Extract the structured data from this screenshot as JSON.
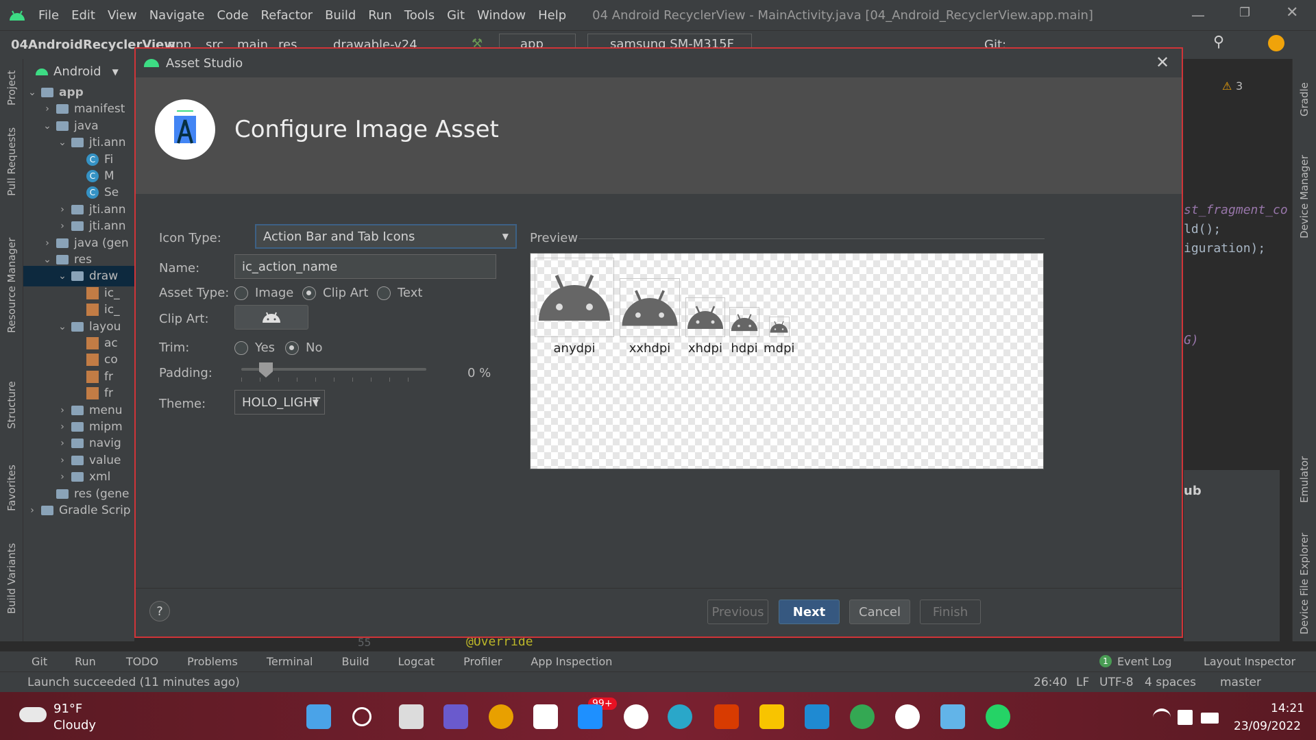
{
  "menu": {
    "items": [
      "File",
      "Edit",
      "View",
      "Navigate",
      "Code",
      "Refactor",
      "Build",
      "Run",
      "Tools",
      "Git",
      "Window",
      "Help"
    ],
    "window_title": "04 Android RecyclerView - MainActivity.java [04_Android_RecyclerView.app.main]"
  },
  "navbar": {
    "project": "04AndroidRecyclerView",
    "crumbs": [
      "app",
      "src",
      "main",
      "res",
      "drawable-v24"
    ],
    "run_config": "app",
    "device": "samsung SM-M315F",
    "git_label": "Git:"
  },
  "left_strip": [
    "Project",
    "Pull Requests",
    "Resource Manager",
    "Structure",
    "Favorites",
    "Build Variants"
  ],
  "right_strip": [
    "Gradle",
    "Device Manager",
    "Emulator",
    "Device File Explorer"
  ],
  "project_panel": {
    "mode": "Android",
    "tree": [
      {
        "label": "app",
        "indent": 0,
        "arrow": "v",
        "kind": "folder",
        "bold": true
      },
      {
        "label": "manifest",
        "indent": 1,
        "arrow": ">",
        "kind": "folder"
      },
      {
        "label": "java",
        "indent": 1,
        "arrow": "v",
        "kind": "folder"
      },
      {
        "label": "jti.ann",
        "indent": 2,
        "arrow": "v",
        "kind": "folder"
      },
      {
        "label": "Fi",
        "indent": 3,
        "arrow": "",
        "kind": "class"
      },
      {
        "label": "M",
        "indent": 3,
        "arrow": "",
        "kind": "class"
      },
      {
        "label": "Se",
        "indent": 3,
        "arrow": "",
        "kind": "class"
      },
      {
        "label": "jti.ann",
        "indent": 2,
        "arrow": ">",
        "kind": "folder"
      },
      {
        "label": "jti.ann",
        "indent": 2,
        "arrow": ">",
        "kind": "folder"
      },
      {
        "label": "java (gen",
        "indent": 1,
        "arrow": ">",
        "kind": "folder"
      },
      {
        "label": "res",
        "indent": 1,
        "arrow": "v",
        "kind": "folder"
      },
      {
        "label": "draw",
        "indent": 2,
        "arrow": "v",
        "kind": "folder",
        "selected": true
      },
      {
        "label": "ic_",
        "indent": 3,
        "arrow": "",
        "kind": "xml"
      },
      {
        "label": "ic_",
        "indent": 3,
        "arrow": "",
        "kind": "xml"
      },
      {
        "label": "layou",
        "indent": 2,
        "arrow": "v",
        "kind": "folder"
      },
      {
        "label": "ac",
        "indent": 3,
        "arrow": "",
        "kind": "xml"
      },
      {
        "label": "co",
        "indent": 3,
        "arrow": "",
        "kind": "xml"
      },
      {
        "label": "fr",
        "indent": 3,
        "arrow": "",
        "kind": "xml"
      },
      {
        "label": "fr",
        "indent": 3,
        "arrow": "",
        "kind": "xml"
      },
      {
        "label": "menu",
        "indent": 2,
        "arrow": ">",
        "kind": "folder"
      },
      {
        "label": "mipm",
        "indent": 2,
        "arrow": ">",
        "kind": "folder"
      },
      {
        "label": "navig",
        "indent": 2,
        "arrow": ">",
        "kind": "folder"
      },
      {
        "label": "value",
        "indent": 2,
        "arrow": ">",
        "kind": "folder"
      },
      {
        "label": "xml",
        "indent": 2,
        "arrow": ">",
        "kind": "folder"
      },
      {
        "label": "res (gene",
        "indent": 1,
        "arrow": "",
        "kind": "folder"
      },
      {
        "label": "Gradle Scrip",
        "indent": 0,
        "arrow": ">",
        "kind": "folder"
      }
    ]
  },
  "editor": {
    "warnings": "3",
    "code_lines": [
      "st_fragment_co",
      "ld();",
      "iguration);",
      "G)"
    ],
    "line_number": "55",
    "annotation": "@Override",
    "side_text": "ub"
  },
  "dialog": {
    "title": "Asset Studio",
    "heading": "Configure Image Asset",
    "icon_type_label": "Icon Type:",
    "icon_type_value": "Action Bar and Tab Icons",
    "name_label": "Name:",
    "name_value": "ic_action_name",
    "asset_type_label": "Asset Type:",
    "asset_type_options": [
      "Image",
      "Clip Art",
      "Text"
    ],
    "asset_type_selected": "Clip Art",
    "clip_art_label": "Clip Art:",
    "trim_label": "Trim:",
    "trim_options": [
      "Yes",
      "No"
    ],
    "trim_selected": "No",
    "padding_label": "Padding:",
    "padding_value": "0 %",
    "padding_fraction": 0.0,
    "theme_label": "Theme:",
    "theme_value": "HOLO_LIGHT",
    "preview_label": "Preview",
    "preview_items": [
      "anydpi",
      "xxhdpi",
      "xhdpi",
      "hdpi",
      "mdpi"
    ],
    "buttons": {
      "help": "?",
      "previous": "Previous",
      "next": "Next",
      "cancel": "Cancel",
      "finish": "Finish"
    }
  },
  "bottom_tools": [
    "Git",
    "Run",
    "TODO",
    "Problems",
    "Terminal",
    "Build",
    "Logcat",
    "Profiler",
    "App Inspection",
    "Event Log",
    "Layout Inspector"
  ],
  "event_log_count": "1",
  "status": {
    "message": "Launch succeeded (11 minutes ago)",
    "position": "26:40",
    "line_sep": "LF",
    "encoding": "UTF-8",
    "indent": "4 spaces",
    "branch": "master"
  },
  "taskbar": {
    "weather_temp": "91°F",
    "weather_desc": "Cloudy",
    "mail_badge": "99+",
    "time": "14:21",
    "date": "23/09/2022"
  },
  "colors": {
    "accent": "#365880",
    "dialog_border": "#d13438",
    "android_green": "#3ddc84"
  }
}
